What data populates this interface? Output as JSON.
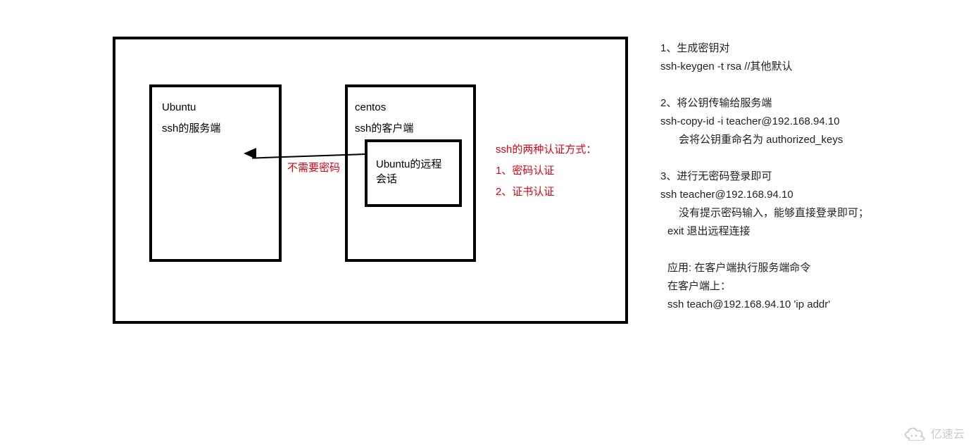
{
  "diagram": {
    "ubuntu": {
      "title": "Ubuntu",
      "role": "ssh的服务端"
    },
    "centos": {
      "title": "centos",
      "role": "ssh的客户端"
    },
    "inner": {
      "line1": "Ubuntu的远程",
      "line2": "会话"
    },
    "arrow_caption": "不需要密码",
    "ssh_auth": {
      "heading": "ssh的两种认证方式：",
      "item1": "1、密码认证",
      "item2": "2、证书认证"
    }
  },
  "notes": {
    "b1_l1": "1、生成密钥对",
    "b1_l2": "ssh-keygen -t rsa  //其他默认",
    "b2_l1": "2、将公钥传输给服务端",
    "b2_l2": "ssh-copy-id  -i teacher@192.168.94.10",
    "b2_l3": "会将公钥重命名为 authorized_keys",
    "b3_l1": "3、进行无密码登录即可",
    "b3_l2": "ssh teacher@192.168.94.10",
    "b3_l3": "没有提示密码输入，能够直接登录即可；",
    "b3_l4": "exit 退出远程连接",
    "b4_l1": "应用:  在客户端执行服务端命令",
    "b4_l2": "在客户端上：",
    "b4_l3": "ssh teach@192.168.94.10 'ip addr'"
  },
  "watermark": {
    "text": "亿速云"
  }
}
